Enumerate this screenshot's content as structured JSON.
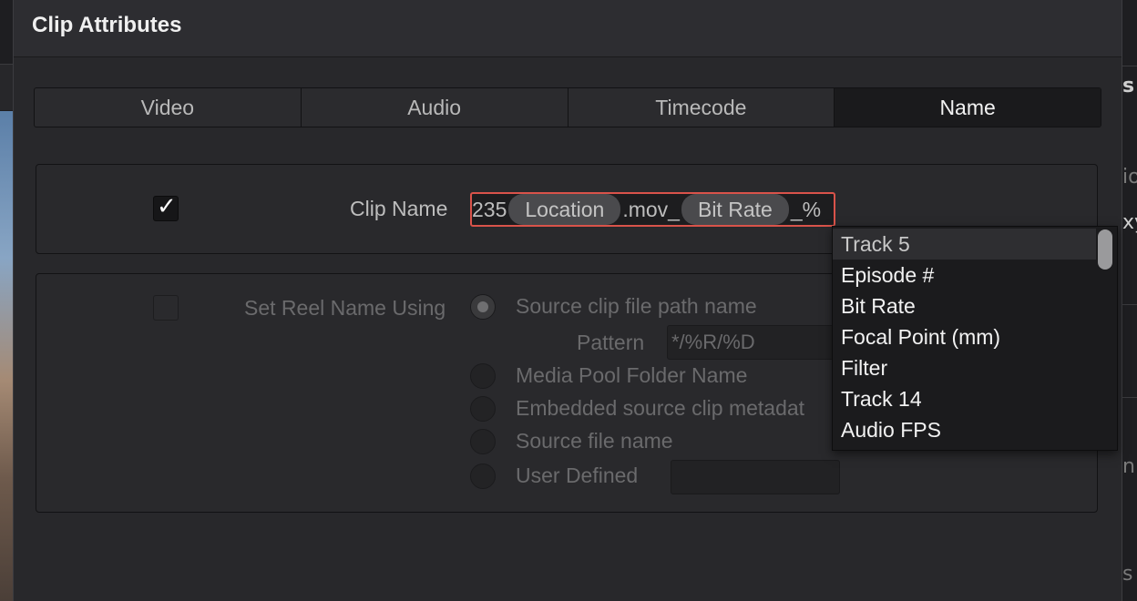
{
  "dialog": {
    "title": "Clip Attributes"
  },
  "tabs": [
    {
      "label": "Video",
      "active": false
    },
    {
      "label": "Audio",
      "active": false
    },
    {
      "label": "Timecode",
      "active": false
    },
    {
      "label": "Name",
      "active": true
    }
  ],
  "clip_name": {
    "checked": true,
    "label": "Clip Name",
    "segments": {
      "prefix": "235",
      "token1": "Location",
      "middle": ".mov_",
      "token2": "Bit Rate",
      "suffix": "_%"
    }
  },
  "reel": {
    "checked": false,
    "label": "Set Reel Name Using",
    "options": [
      {
        "label": "Source clip file path name",
        "selected": true
      },
      {
        "label": "Media Pool Folder Name",
        "selected": false
      },
      {
        "label": "Embedded source clip metadat",
        "selected": false
      },
      {
        "label": "Source file name",
        "selected": false
      },
      {
        "label": "User Defined",
        "selected": false
      }
    ],
    "pattern_label": "Pattern",
    "pattern_value": "*/%R/%D",
    "user_defined_value": ""
  },
  "dropdown": {
    "items": [
      "Track 5",
      "Episode #",
      "Bit Rate",
      "Focal Point (mm)",
      "Filter",
      "Track 14",
      "Audio FPS"
    ],
    "highlighted_index": 0
  },
  "background": {
    "right_glyphs": [
      "s",
      "io",
      "xy",
      "n",
      "s"
    ]
  }
}
